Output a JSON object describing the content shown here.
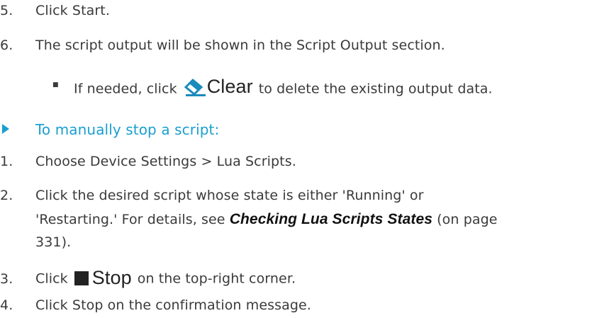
{
  "steps_a": [
    {
      "num": "5.",
      "text": "Click Start."
    },
    {
      "num": "6.",
      "text": "The script output will be shown in the Script Output section."
    }
  ],
  "bullet": {
    "mark": "■",
    "pre": "If needed, click",
    "button_label": "Clear",
    "button_icon": "eraser-icon",
    "post": "to delete the existing output data."
  },
  "heading": {
    "icon": "triangle-right-icon",
    "text": "To manually stop a script:"
  },
  "steps_b": {
    "s1": {
      "num": "1.",
      "text": "Choose Device Settings > Lua Scripts."
    },
    "s2": {
      "num": "2.",
      "line1": "Click the desired script whose state is either 'Running' or",
      "line2_pre": "'Restarting.' For details, see",
      "link": "Checking Lua Scripts States",
      "line2_post": "(on page",
      "line3": "331)."
    },
    "s3": {
      "num": "3.",
      "pre": "Click",
      "button_label": "Stop",
      "button_icon": "stop-square-icon",
      "post": "on the top-right corner."
    },
    "s4": {
      "num": "4.",
      "text": "Click Stop on the confirmation message."
    }
  },
  "colors": {
    "heading": "#1a9fcf",
    "eraser_icon": "#1a8bbd",
    "text": "#3a3a3a"
  }
}
